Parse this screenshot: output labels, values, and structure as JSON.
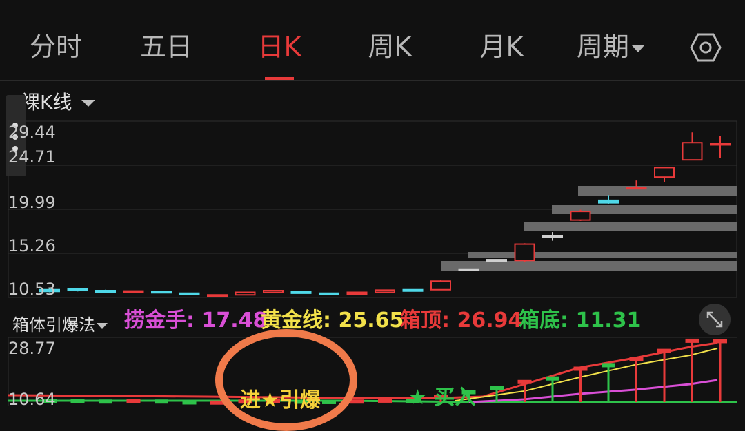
{
  "tabs": [
    {
      "label": "分时",
      "active": false
    },
    {
      "label": "五日",
      "active": false
    },
    {
      "label": "日K",
      "active": true
    },
    {
      "label": "周K",
      "active": false
    },
    {
      "label": "月K",
      "active": false
    },
    {
      "label": "周期",
      "active": false
    }
  ],
  "settings_icon": "hexagon-gear-icon",
  "kline": {
    "title": "裸K线",
    "y_labels": [
      "29.44",
      "24.71",
      "19.99",
      "15.26",
      "10.53"
    ]
  },
  "indicator": {
    "name": "箱体引爆法",
    "values": [
      {
        "label": "捞金手: 17.48",
        "color": "#d94fd6"
      },
      {
        "label": "黄金线: 25.65",
        "color": "#f2e14a"
      },
      {
        "label": "箱顶: 26.94",
        "color": "#e83a3a"
      },
      {
        "label": "箱底: 11.31",
        "color": "#2ec24a"
      }
    ],
    "y_labels": [
      "28.77",
      "10.64"
    ],
    "signal_burst": "进★引爆",
    "signal_buy": "★ 买入"
  },
  "colors": {
    "up": "#e83a3a",
    "down": "#4fd8e8",
    "flat": "#cfcfcf",
    "accent": "#e83a3a",
    "annotation": "#f07a4a"
  },
  "chart_data": {
    "type": "candlestick",
    "ylim": [
      10.0,
      30.5
    ],
    "candles": [
      {
        "o": 10.9,
        "c": 10.7,
        "h": 11.0,
        "l": 10.6
      },
      {
        "o": 11.0,
        "c": 10.8,
        "h": 11.1,
        "l": 10.7
      },
      {
        "o": 10.8,
        "c": 10.6,
        "h": 10.9,
        "l": 10.5
      },
      {
        "o": 10.6,
        "c": 10.75,
        "h": 10.8,
        "l": 10.5
      },
      {
        "o": 10.7,
        "c": 10.6,
        "h": 10.75,
        "l": 10.5
      },
      {
        "o": 10.5,
        "c": 10.35,
        "h": 10.55,
        "l": 10.3
      },
      {
        "o": 10.2,
        "c": 10.3,
        "h": 10.35,
        "l": 10.15
      },
      {
        "o": 10.3,
        "c": 10.6,
        "h": 10.65,
        "l": 10.25
      },
      {
        "o": 10.6,
        "c": 10.8,
        "h": 10.85,
        "l": 10.55
      },
      {
        "o": 10.65,
        "c": 10.55,
        "h": 10.7,
        "l": 10.5
      },
      {
        "o": 10.5,
        "c": 10.45,
        "h": 10.55,
        "l": 10.4
      },
      {
        "o": 10.4,
        "c": 10.6,
        "h": 10.65,
        "l": 10.35
      },
      {
        "o": 10.6,
        "c": 10.85,
        "h": 10.9,
        "l": 10.55
      },
      {
        "o": 10.9,
        "c": 10.8,
        "h": 10.95,
        "l": 10.75
      },
      {
        "o": 10.9,
        "c": 11.9,
        "h": 12.0,
        "l": 10.85
      },
      {
        "o": 13.3,
        "c": 13.3,
        "h": 13.3,
        "l": 13.3
      },
      {
        "o": 14.4,
        "c": 14.4,
        "h": 14.4,
        "l": 14.4
      },
      {
        "o": 14.3,
        "c": 16.2,
        "h": 16.3,
        "l": 14.1
      },
      {
        "o": 17.2,
        "c": 17.2,
        "h": 17.6,
        "l": 16.6
      },
      {
        "o": 19.0,
        "c": 20.0,
        "h": 20.2,
        "l": 18.9
      },
      {
        "o": 21.3,
        "c": 21.0,
        "h": 21.9,
        "l": 20.9
      },
      {
        "o": 22.7,
        "c": 22.8,
        "h": 23.6,
        "l": 22.6
      },
      {
        "o": 24.0,
        "c": 25.1,
        "h": 25.2,
        "l": 23.4
      },
      {
        "o": 26.0,
        "c": 28.0,
        "h": 29.2,
        "l": 26.0
      },
      {
        "o": 27.8,
        "c": 27.9,
        "h": 28.8,
        "l": 26.2
      }
    ]
  }
}
